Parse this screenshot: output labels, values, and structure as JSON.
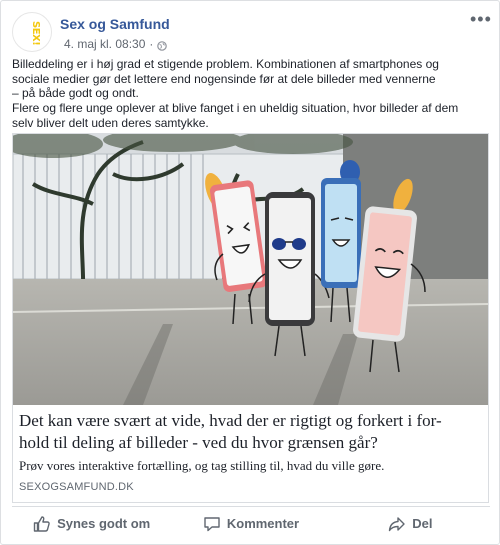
{
  "post": {
    "page_name": "Sex og Samfund",
    "avatar_text": "SEX!",
    "timestamp": "4. maj kl. 08:30",
    "separator": "·",
    "privacy_icon": "globe-icon",
    "more_icon": "ellipsis-icon",
    "text_lines": [
      "Billeddeling er i høj grad et stigende problem. Kombinationen af smartphones og",
      "sociale medier gør det lettere end  nogensinde før at dele billeder med vennerne",
      "– på både godt og ondt.",
      "Flere og flere unge oplever at blive fanget i en uheldig situation, hvor billeder af dem",
      "selv bliver delt uden deres samtykke."
    ]
  },
  "link_preview": {
    "image_description_icon": "cartoon-phones-image",
    "title": "Det kan være svært at vide, hvad der er rigtigt og forkert i for-hold til deling af billeder - ved du hvor grænsen går?",
    "title_line1": "Det kan være svært at vide, hvad der er rigtigt og forkert i for-",
    "title_line2": "hold til deling af billeder - ved du hvor grænsen går?",
    "description": "Prøv vores interaktive fortælling, og tag stilling til, hvad du ville gøre.",
    "domain": "SEXOGSAMFUND.DK"
  },
  "actions": {
    "like": {
      "label": "Synes godt om",
      "icon": "thumbs-up-icon"
    },
    "comment": {
      "label": "Kommenter",
      "icon": "comment-icon"
    },
    "share": {
      "label": "Del",
      "icon": "share-icon"
    }
  },
  "colors": {
    "link_blue": "#365899",
    "meta_gray": "#616770",
    "accent_yellow": "#f3c80f"
  }
}
